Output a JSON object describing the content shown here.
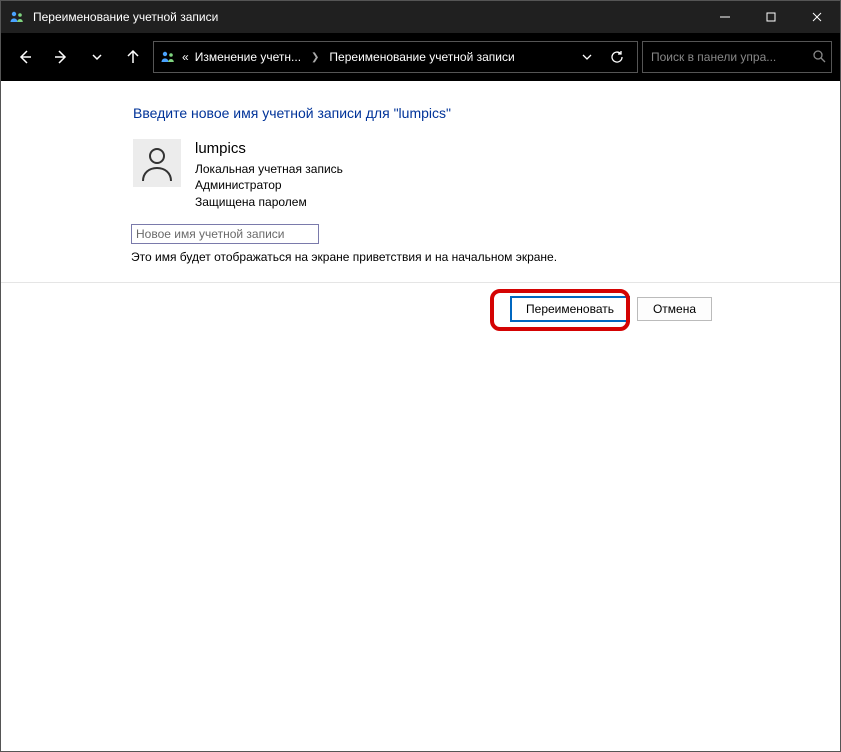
{
  "titlebar": {
    "title": "Переименование учетной записи"
  },
  "nav": {
    "crumb_prefix": "«",
    "crumb1": "Изменение учетн...",
    "crumb2": "Переименование учетной записи"
  },
  "search": {
    "placeholder": "Поиск в панели упра..."
  },
  "main": {
    "heading": "Введите новое имя учетной записи для \"lumpics\"",
    "account": {
      "name": "lumpics",
      "type": "Локальная учетная запись",
      "role": "Администратор",
      "protected": "Защищена паролем"
    },
    "new_name_placeholder": "Новое имя учетной записи",
    "hint": "Это имя будет отображаться на экране приветствия и на начальном экране."
  },
  "buttons": {
    "rename": "Переименовать",
    "cancel": "Отмена"
  }
}
